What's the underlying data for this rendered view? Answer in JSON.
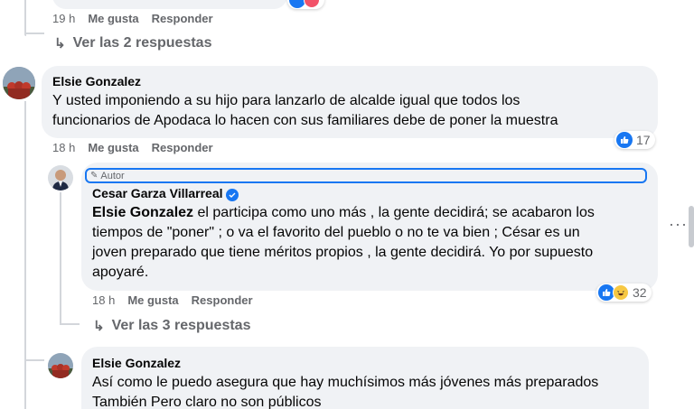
{
  "top": {
    "time": "19 h",
    "like": "Me gusta",
    "reply": "Responder",
    "replies_link": "Ver las 2 respuestas"
  },
  "c1": {
    "author": "Elsie Gonzalez",
    "text_line1": "Y usted imponiendo a su hijo para lanzarlo de alcalde igual que todos los",
    "text_line2": "funcionarios de Apodaca lo hacen con sus familiares debe de poner la muestra",
    "time": "18 h",
    "like": "Me gusta",
    "reply": "Responder",
    "reaction_count": "17"
  },
  "c2": {
    "badge": "Autor",
    "author": "Cesar Garza Villarreal",
    "mention": "Elsie Gonzalez",
    "text_line1": " el participa como uno más , la gente decidirá; se acabaron los",
    "text_line2": "tiempos de \"poner\" ; o va el favorito del pueblo o no te va bien ; César es un",
    "text_line3": "joven preparado que tiene méritos propios , la gente decidirá. Yo por supuesto",
    "text_line4": "apoyaré.",
    "time": "18 h",
    "like": "Me gusta",
    "reply": "Responder",
    "reaction_count": "32",
    "replies_link": "Ver las 3 respuestas"
  },
  "c3": {
    "author": "Elsie Gonzalez",
    "text_line1": "Así como le puedo asegura que hay muchísimos más jóvenes más preparados",
    "text_line2": "También Pero claro no son públicos"
  },
  "more": "···",
  "colors": {
    "accent": "#1877f2",
    "bubble": "#f0f2f5",
    "muted": "#65676b"
  }
}
